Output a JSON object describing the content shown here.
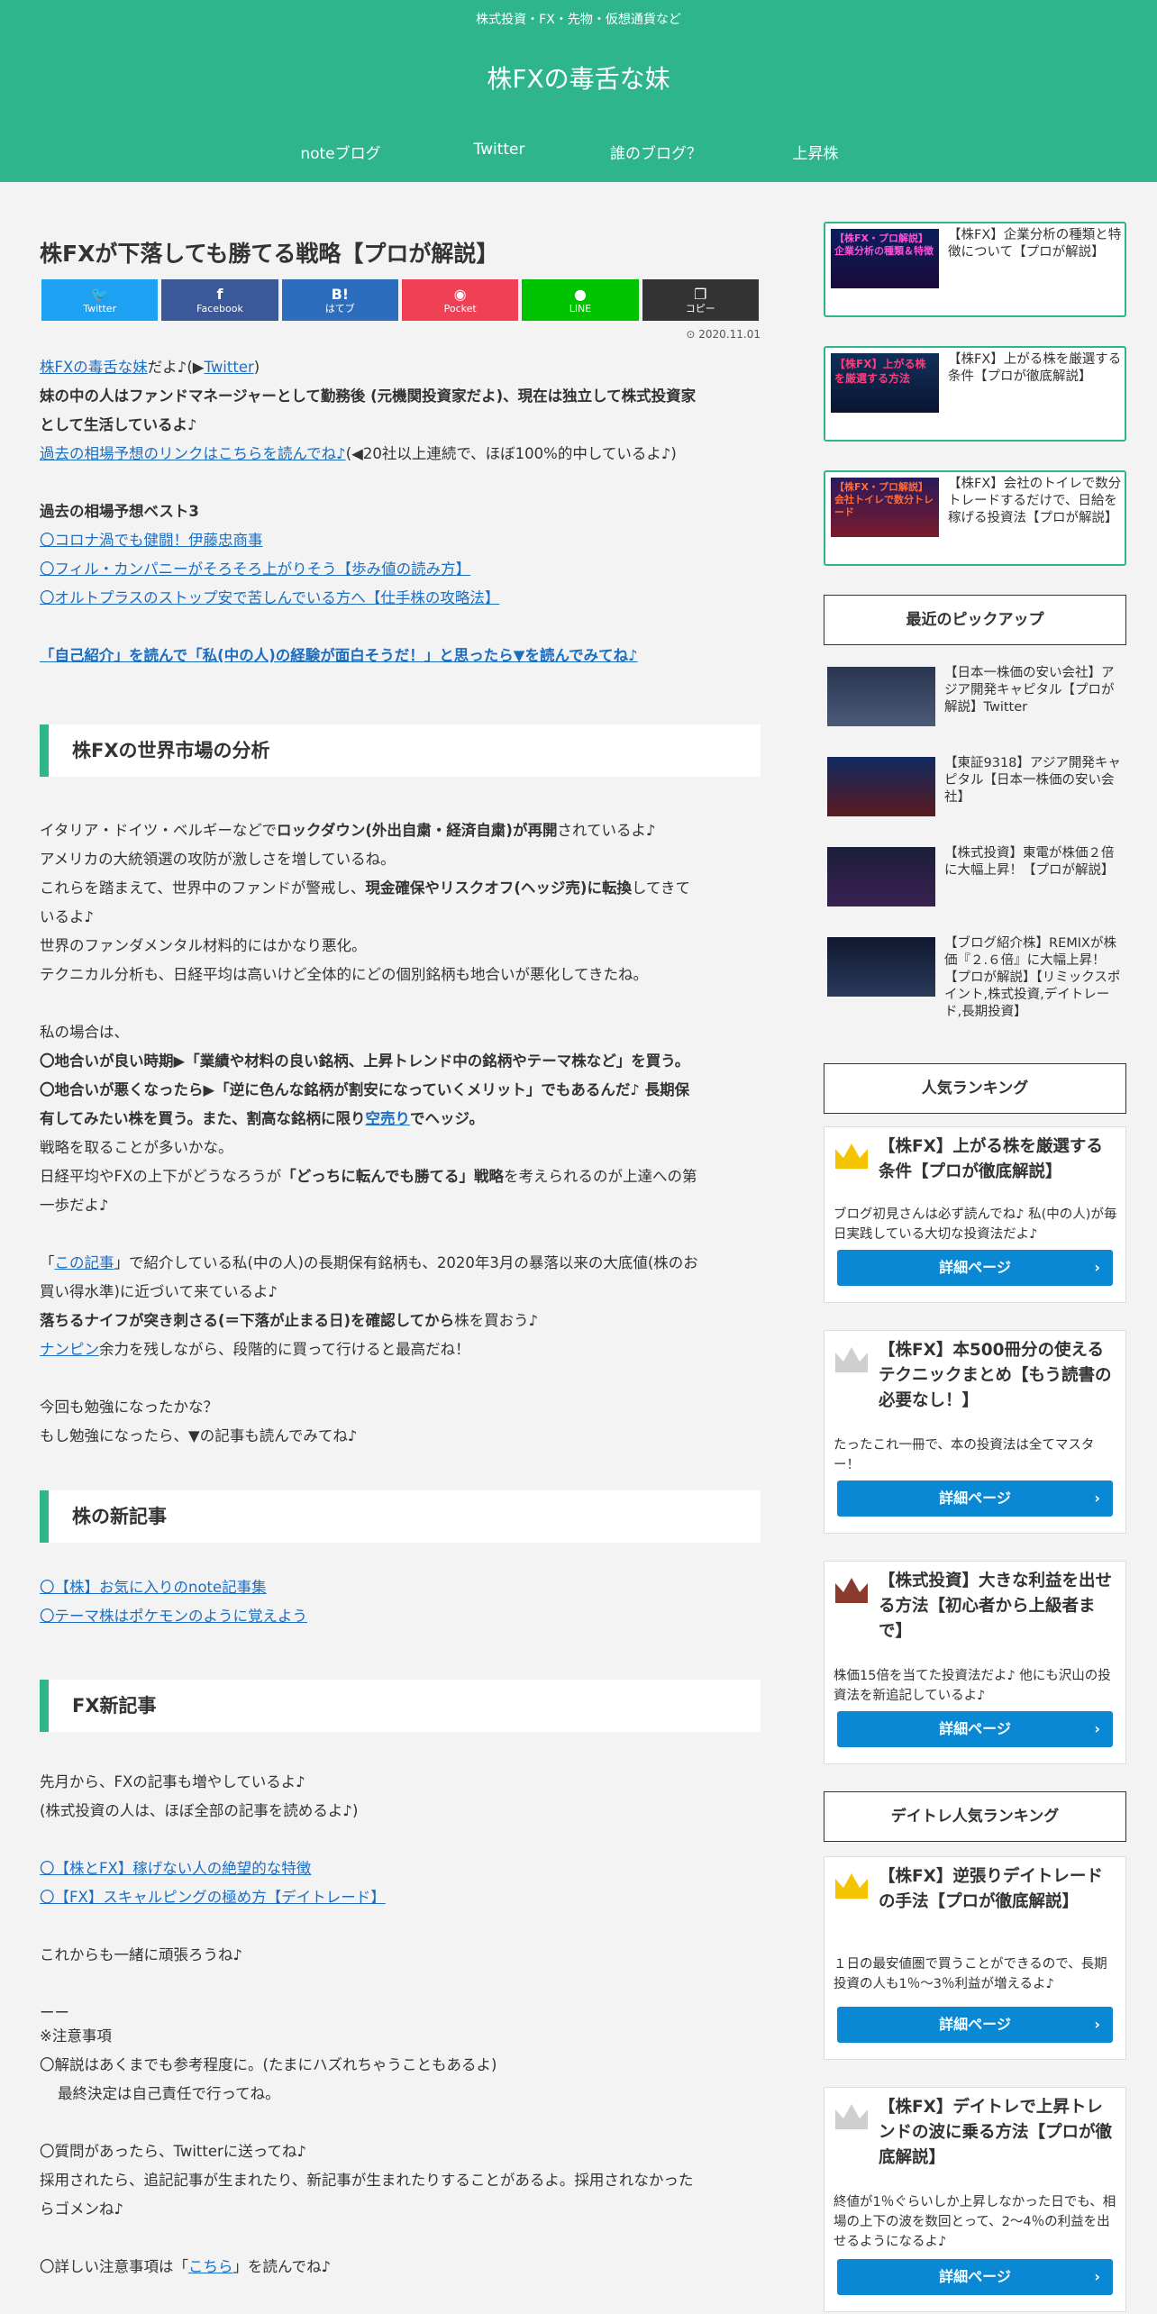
{
  "header": {
    "tagline": "株式投資・FX・先物・仮想通貨など",
    "title": "株FXの毒舌な妹",
    "nav": [
      "noteブログ",
      "Twitter",
      "誰のブログ？",
      "上昇株"
    ]
  },
  "post": {
    "title": "株FXが下落しても勝てる戦略【プロが解説】",
    "date": "2020.11.01",
    "share": [
      {
        "icon": "twitter-icon",
        "glyph": "🐦",
        "label": "Twitter",
        "color": "#1da1f2"
      },
      {
        "icon": "facebook-icon",
        "glyph": "f",
        "label": "Facebook",
        "color": "#3b5998"
      },
      {
        "icon": "hatena-icon",
        "glyph": "B!",
        "label": "はてブ",
        "color": "#2c6ebd"
      },
      {
        "icon": "pocket-icon",
        "glyph": "◉",
        "label": "Pocket",
        "color": "#ef4056"
      },
      {
        "icon": "line-icon",
        "glyph": "●",
        "label": "LINE",
        "color": "#00c300"
      },
      {
        "icon": "copy-icon",
        "glyph": "❐",
        "label": "コピー",
        "color": "#333333"
      }
    ],
    "intro": {
      "blog_link": "株FXの毒舌な妹",
      "t1": "だよ♪(▶",
      "twitter_link": "Twitter",
      "t2": ")",
      "bold1": "妹の中の人はファンドマネージャーとして勤務後 (元機関投資家だよ)、現在は独立して株式投資家",
      "bold2": "として生活しているよ♪",
      "past_link": "過去の相場予想のリンクはこちらを読んでね♪",
      "past_note": "(◀20社以上連続で、ほぼ100%的中しているよ♪)"
    },
    "best3": {
      "heading": "過去の相場予想ベスト3",
      "links": [
        "〇コロナ渦でも健闘！伊藤忠商事",
        "〇フィル・カンパニーがそろそろ上がりそう【歩み値の読み方】",
        "〇オルトプラスのストップ安で苦しんでいる方へ【仕手株の攻略法】"
      ]
    },
    "jiko_link": "「自己紹介」を読んで「私(中の人)の経験が面白そうだ！」と思ったら▼を読んでみてね♪",
    "section1": {
      "heading": "株FXの世界市場の分析",
      "l1a": "イタリア・ドイツ・ベルギーなどで",
      "l1b": "ロックダウン(外出自粛・経済自粛)が再開",
      "l1c": "されているよ♪",
      "l2": "アメリカの大統領選の攻防が激しさを増しているね。",
      "l3a": "これらを踏まえて、世界中のファンドが警戒し、",
      "l3b": "現金確保やリスクオフ(ヘッジ売)に転換",
      "l3c": "してきて",
      "l4": "いるよ♪",
      "l5": "世界のファンダメンタル材料的にはかなり悪化。",
      "l6": "テクニカル分析も、日経平均は高いけど全体的にどの個別銘柄も地合いが悪化してきたね。",
      "l7": "私の場合は、",
      "l8": "〇地合いが良い時期▶「業績や材料の良い銘柄、上昇トレンド中の銘柄やテーマ株など」を買う。",
      "l9": "〇地合いが悪くなったら▶「逆に色んな銘柄が割安になっていくメリット」でもあるんだ♪ 長期保",
      "l10a": "有してみたい株を買う。また、割高な銘柄に限り",
      "l10link": "空売り",
      "l10b": "でヘッジ。",
      "l11": "戦略を取ることが多いかな。",
      "l12a": "日経平均やFXの上下がどうなろうが",
      "l12b": "「どっちに転んでも勝てる」戦略",
      "l12c": "を考えられるのが上達への第",
      "l13": "一歩だよ♪",
      "l14a": "「",
      "l14link": "この記事",
      "l14b": "」で紹介している私(中の人)の長期保有銘柄も、2020年3月の暴落以来の大底値(株のお",
      "l15": "買い得水準)に近づいて来ているよ♪",
      "l16a": "落ちるナイフが突き刺さる(＝下落が止まる日)を確認してから",
      "l16b": "株を買おう♪",
      "l17link": "ナンピン",
      "l17b": "余力を残しながら、段階的に買って行けると最高だね！",
      "l18": "今回も勉強になったかな？",
      "l19": "もし勉強になったら、▼の記事も読んでみてね♪"
    },
    "section2": {
      "heading": "株の新記事",
      "links": [
        "〇【株】お気に入りのnote記事集",
        "〇テーマ株はポケモンのように覚えよう"
      ]
    },
    "section3": {
      "heading": "FX新記事",
      "l1": "先月から、FXの記事も増やしているよ♪",
      "l2": "(株式投資の人は、ほぼ全部の記事を読めるよ♪)",
      "links": [
        "〇【株とFX】稼げない人の絶望的な特徴",
        "〇【FX】スキャルピングの極め方【デイトレード】"
      ],
      "l3": "これからも一緒に頑張ろうね♪"
    },
    "notes": {
      "dash": "ーー",
      "h": "※注意事項",
      "n1": "〇解説はあくまでも参考程度に。(たまにハズれちゃうこともあるよ)",
      "n2": "最終決定は自己責任で行ってね。",
      "n3": "〇質問があったら、Twitterに送ってね♪",
      "n4": "採用されたら、追記記事が生まれたり、新記事が生まれたりすることがあるよ。採用されなかった",
      "n5": "らゴメンね♪",
      "n6a": "〇詳しい注意事項は「",
      "n6link": "こちら",
      "n6b": "」を読んでね♪"
    }
  },
  "sidebar": {
    "cards": [
      {
        "title": "【株FX】企業分析の種類と特徴について【プロが解説】",
        "thumb": "【株FX・プロ解説】企業分析の種類＆特徴"
      },
      {
        "title": "【株FX】上がる株を厳選する条件【プロが徹底解説】",
        "thumb": "【株FX】上がる株を厳選する方法"
      },
      {
        "title": "【株FX】会社のトイレで数分トレードするだけで、日給を稼げる投資法【プロが解説】",
        "thumb": "【株FX・プロ解説】会社トイレで数分トレード"
      }
    ],
    "pickup_heading": "最近のピックアップ",
    "pickups": [
      {
        "title": "【日本一株価の安い会社】アジア開発キャピタル【プロが解説】Twitter"
      },
      {
        "title": "【東証9318】アジア開発キャピタル【日本一株価の安い会社】"
      },
      {
        "title": "【株式投資】東電が株価２倍に大幅上昇！【プロが解説】"
      },
      {
        "title": "【ブログ紹介株】REMIXが株価『２.６倍』に大幅上昇！【プロが解説】【リミックスポイント,株式投資,デイトレード,長期投資】"
      }
    ],
    "ranking_heading": "人気ランキング",
    "ranking": [
      {
        "title": "【株FX】上がる株を厳選する条件【プロが徹底解説】",
        "desc": "ブログ初見さんは必ず読んでね♪ 私(中の人)が毎日実践している大切な投資法だよ♪",
        "crown": "#f5c400"
      },
      {
        "title": "【株FX】本500冊分の使えるテクニックまとめ【もう読書の必要なし！】",
        "desc": "たったこれ一冊で、本の投資法は全てマスター！",
        "crown": "#c8c8c8"
      },
      {
        "title": "【株式投資】大きな利益を出せる方法【初心者から上級者まで】",
        "desc": "株価15倍を当てた投資法だよ♪ 他にも沢山の投資法を新追記しているよ♪",
        "crown": "#8b3a2e"
      }
    ],
    "daytrade_heading": "デイトレ人気ランキング",
    "daytrade": [
      {
        "title": "【株FX】逆張りデイトレードの手法【プロが徹底解説】",
        "desc": "１日の最安値圏で買うことができるので、長期投資の人も1％～3％利益が増えるよ♪",
        "crown": "#f5c400"
      },
      {
        "title": "【株FX】デイトレで上昇トレンドの波に乗る方法【プロが徹底解説】",
        "desc": "終値が1％ぐらいしか上昇しなかった日でも、相場の上下の波を数回とって、2～4％の利益を出せるようになるよ♪",
        "crown": "#c8c8c8"
      }
    ],
    "detail_label": "詳細ページ",
    "arrow": "›"
  }
}
